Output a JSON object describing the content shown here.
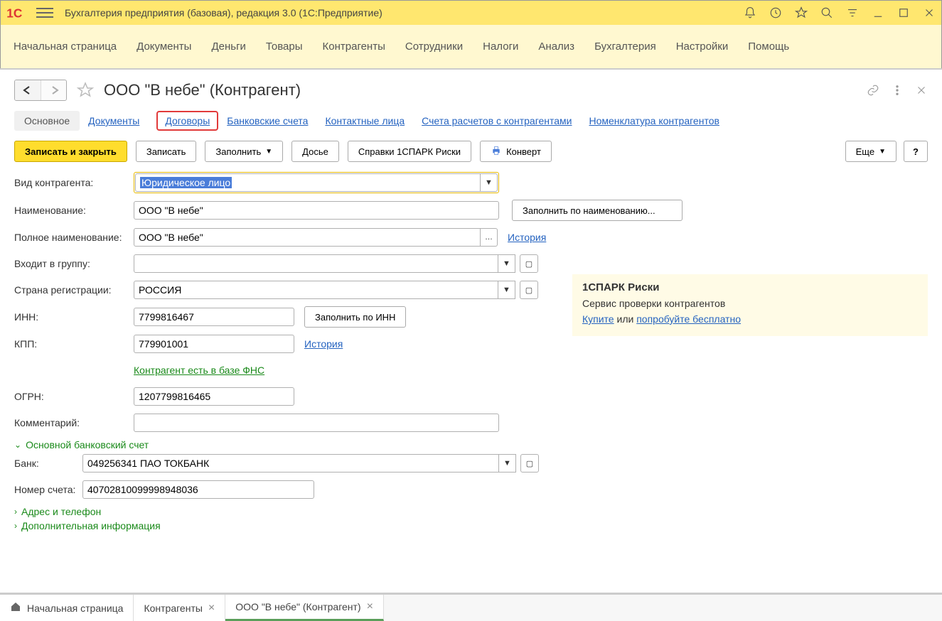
{
  "app": {
    "title": "Бухгалтерия предприятия (базовая), редакция 3.0  (1С:Предприятие)"
  },
  "menu": [
    "Начальная страница",
    "Документы",
    "Деньги",
    "Товары",
    "Контрагенты",
    "Сотрудники",
    "Налоги",
    "Анализ",
    "Бухгалтерия",
    "Настройки",
    "Помощь"
  ],
  "page": {
    "title": "ООО \"В небе\" (Контрагент)"
  },
  "tabs": {
    "active": "Основное",
    "items": [
      "Основное",
      "Документы",
      "Договоры",
      "Банковские счета",
      "Контактные лица",
      "Счета расчетов с контрагентами",
      "Номенклатура контрагентов"
    ],
    "highlighted": "Договоры"
  },
  "toolbar": {
    "save_close": "Записать и закрыть",
    "save": "Записать",
    "fill": "Заполнить",
    "dossier": "Досье",
    "risks": "Справки 1СПАРК Риски",
    "envelope": "Конверт",
    "more": "Еще",
    "help": "?"
  },
  "fields": {
    "type_label": "Вид контрагента:",
    "type_value": "Юридическое лицо",
    "name_label": "Наименование:",
    "name_value": "ООО \"В небе\"",
    "fill_by_name": "Заполнить по наименованию...",
    "fullname_label": "Полное наименование:",
    "fullname_value": "ООО \"В небе\"",
    "history": "История",
    "group_label": "Входит в группу:",
    "group_value": "",
    "country_label": "Страна регистрации:",
    "country_value": "РОССИЯ",
    "inn_label": "ИНН:",
    "inn_value": "7799816467",
    "fill_by_inn": "Заполнить по ИНН",
    "kpp_label": "КПП:",
    "kpp_value": "779901001",
    "fns_check": "Контрагент есть в базе ФНС",
    "ogrn_label": "ОГРН:",
    "ogrn_value": "1207799816465",
    "comment_label": "Комментарий:",
    "comment_value": ""
  },
  "sections": {
    "bank": "Основной банковский счет",
    "bank_label": "Банк:",
    "bank_value": "049256341 ПАО ТОКБАНК",
    "account_label": "Номер счета:",
    "account_value": "40702810099998948036",
    "address": "Адрес и телефон",
    "extra": "Дополнительная информация"
  },
  "infobox": {
    "title": "1СПАРК Риски",
    "subtitle": "Сервис проверки контрагентов",
    "buy": "Купите",
    "or": " или ",
    "try": "попробуйте бесплатно"
  },
  "bottom_tabs": {
    "home": "Начальная страница",
    "t1": "Контрагенты",
    "t2": "ООО \"В небе\" (Контрагент)"
  }
}
